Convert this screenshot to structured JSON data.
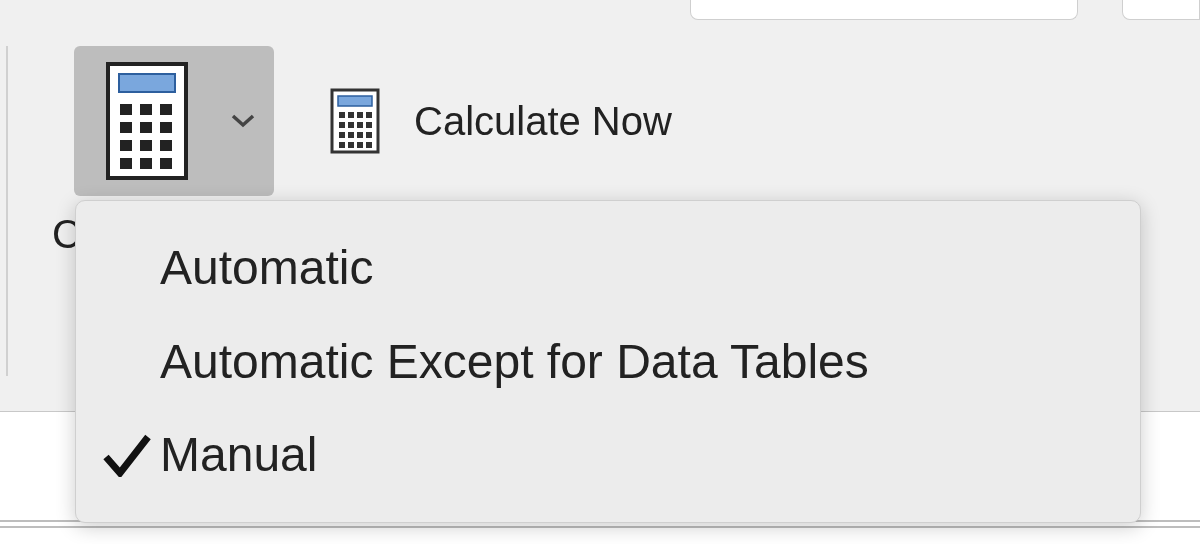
{
  "calculation_options": {
    "pressed": true,
    "label": "C"
  },
  "calculate_now": {
    "label": "Calculate Now"
  },
  "menu": {
    "items": [
      {
        "label": "Automatic",
        "checked": false
      },
      {
        "label": "Automatic Except for Data Tables",
        "checked": false
      },
      {
        "label": "Manual",
        "checked": true
      }
    ]
  }
}
